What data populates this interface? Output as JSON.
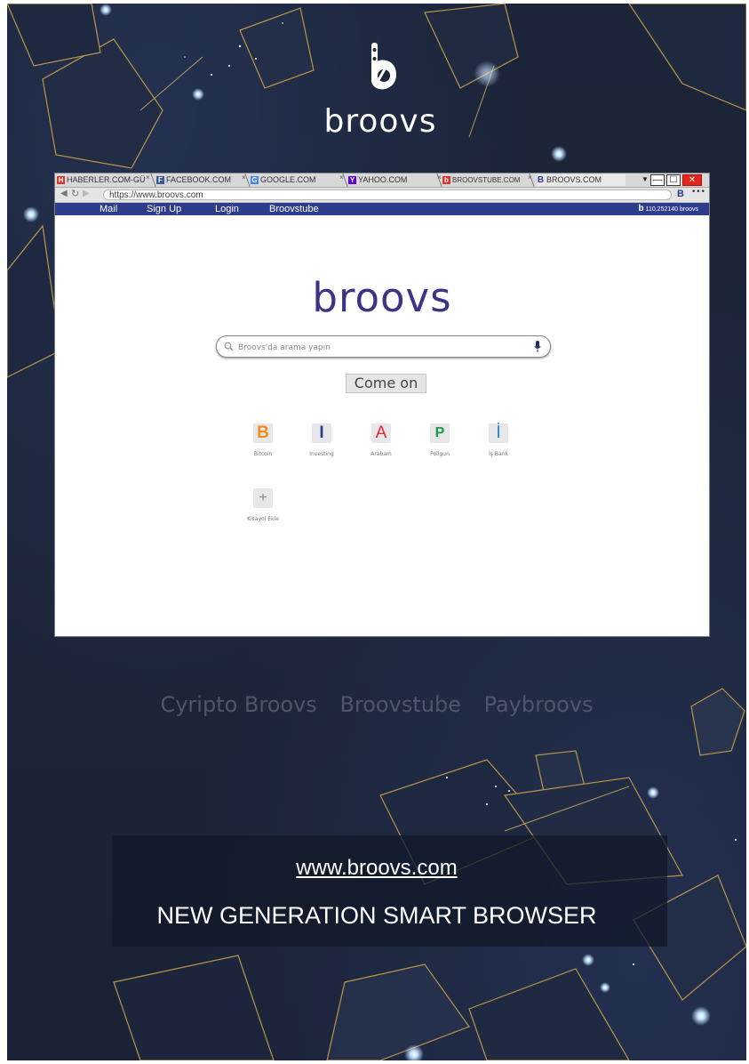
{
  "brand": {
    "name": "broovs"
  },
  "browser": {
    "tabs": [
      {
        "favicon": "H",
        "favicon_color": "#d9342b",
        "label": "HABERLER.COM-GÜ"
      },
      {
        "favicon": "F",
        "favicon_color": "#3b5998",
        "label": "FACEBOOK.COM"
      },
      {
        "favicon": "G",
        "favicon_color": "#4285f4",
        "label": "GOOGLE.COM"
      },
      {
        "favicon": "Y",
        "favicon_color": "#5f01d1",
        "label": "YAHOO.COM"
      },
      {
        "favicon": "b",
        "favicon_color": "#d9342b",
        "label": "BROOVSTUBE.COM"
      },
      {
        "favicon": "B",
        "favicon_color": "#2e3d8b",
        "label": "BROOVS.COM",
        "active": true
      }
    ],
    "url": "https://www.broovs.com",
    "address_badge": "B",
    "menu_dots": "•••",
    "nav_links": [
      "Mail",
      "Sign Up",
      "Login",
      "Broovstube"
    ],
    "counter": "110,252140 broovs",
    "counter_icon": "b"
  },
  "page": {
    "logo": "broovs",
    "search_placeholder": "Broovs'da arama yapın",
    "submit_label": "Come on",
    "shortcuts": [
      {
        "letter": "B",
        "color": "#f28c1e",
        "label": "Bitcoin"
      },
      {
        "letter": "I",
        "color": "#2e3d8b",
        "label": "Investing"
      },
      {
        "letter": "A",
        "color": "#e3262d",
        "label": "Arabam"
      },
      {
        "letter": "P",
        "color": "#1a9a3c",
        "label": "Poligun"
      },
      {
        "letter": "İ",
        "color": "#1f7fd1",
        "label": "İş Bank"
      }
    ],
    "add_shortcut": {
      "symbol": "+",
      "label": "Kısayol Ekle"
    }
  },
  "footer": {
    "products": [
      "Cyripto Broovs",
      "Broovstube",
      "Paybroovs"
    ],
    "site_url": "www.broovs.com",
    "tagline": "NEW GENERATION SMART BROWSER"
  },
  "colors": {
    "background": "#1c2538",
    "nav_strip": "#2e3d8b",
    "logo_purple": "#3a3486",
    "gold_edge": "#c9a24a"
  }
}
